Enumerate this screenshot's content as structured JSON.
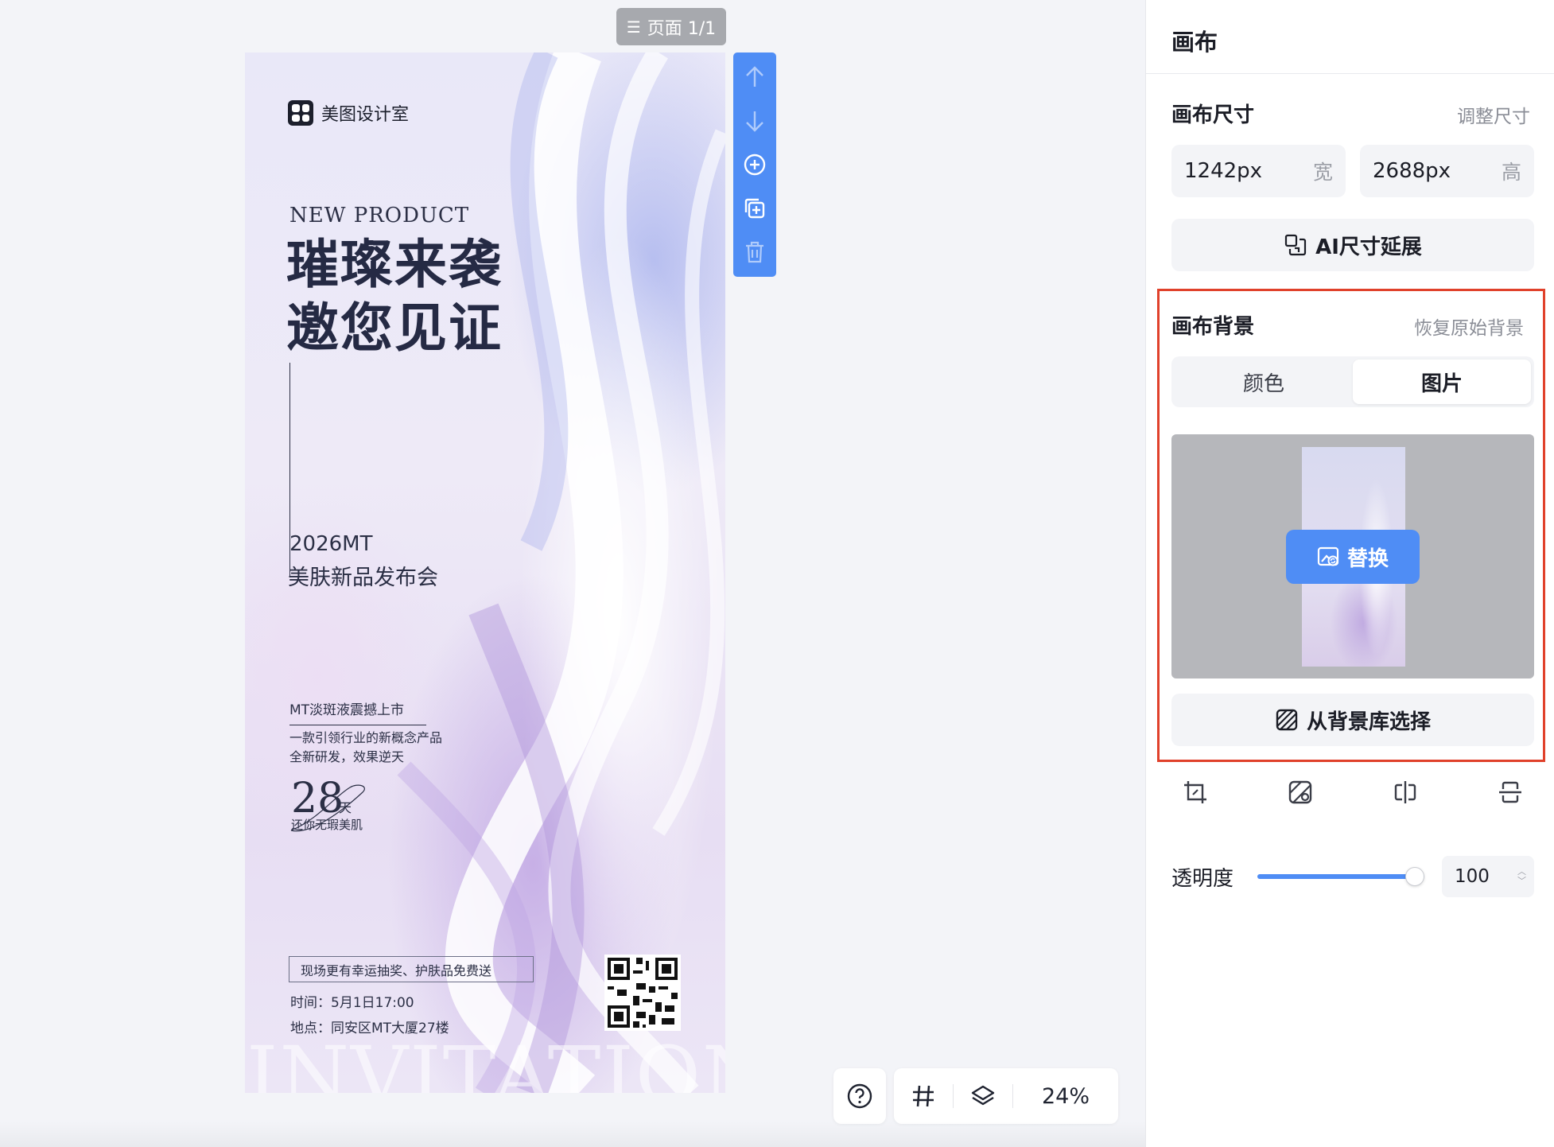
{
  "workspace": {
    "page_indicator": "页面 1/1",
    "zoom": "24%"
  },
  "poster": {
    "brand": "美图设计室",
    "eyebrow": "NEW PRODUCT",
    "headline_line1": "璀璨来袭",
    "headline_line2": "邀您见证",
    "event_year": "2026MT",
    "event_name": "美肤新品发布会",
    "sub_title": "MT淡斑液震撼上市",
    "desc_line1": "一款引领行业的新概念产品",
    "desc_line2": "全新研发，效果逆天",
    "days_number": "28",
    "days_unit": "天",
    "days_caption": "还你无瑕美肌",
    "lucky_draw": "现场更有幸运抽奖、护肤品免费送",
    "time": "时间：5月1日17:00",
    "place": "地点：同安区MT大厦27楼",
    "watermark": "INVITATION"
  },
  "panel": {
    "title": "画布",
    "canvas_size": {
      "title": "画布尺寸",
      "adjust_link": "调整尺寸",
      "width_value": "1242px",
      "width_unit": "宽",
      "height_value": "2688px",
      "height_unit": "高",
      "ai_extend_label": "AI尺寸延展"
    },
    "background": {
      "title": "画布背景",
      "restore_link": "恢复原始背景",
      "tab_color": "颜色",
      "tab_image": "图片",
      "active_tab": "图片",
      "replace_label": "替换",
      "library_label": "从背景库选择"
    },
    "opacity": {
      "label": "透明度",
      "value": "100",
      "level": 1.0
    }
  },
  "colors": {
    "accent": "#4f8df5",
    "highlight": "#e0412b"
  }
}
